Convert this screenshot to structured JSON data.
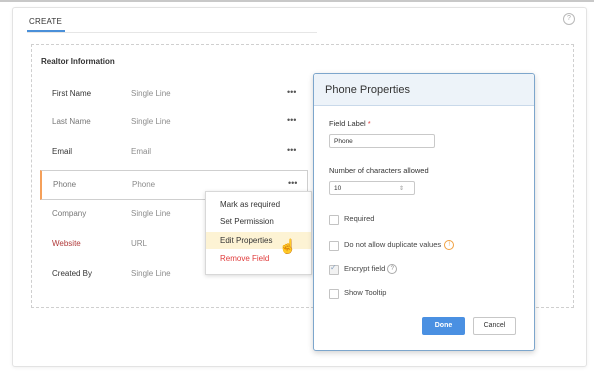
{
  "tabs": {
    "create": "CREATE"
  },
  "help_icon": "?",
  "section": {
    "title": "Realtor Information"
  },
  "fields": [
    {
      "label": "First Name",
      "type": "Single Line",
      "menu": "•••"
    },
    {
      "label": "Last Name",
      "type": "Single Line",
      "menu": "•••"
    },
    {
      "label": "Email",
      "type": "Email",
      "menu": "•••"
    },
    {
      "label": "Phone",
      "type": "Phone",
      "menu": "•••"
    },
    {
      "label": "Company",
      "type": "Single Line"
    },
    {
      "label": "Website",
      "type": "URL"
    },
    {
      "label": "Created By",
      "type": "Single Line"
    }
  ],
  "context_menu": {
    "items": [
      "Mark as required",
      "Set Permission",
      "Edit Properties",
      "Remove Field"
    ]
  },
  "properties": {
    "title": "Phone Properties",
    "field_label_label": "Field Label",
    "required_mark": "*",
    "field_label_value": "Phone",
    "chars_label": "Number of characters allowed",
    "chars_value": "10",
    "chars_arrow": "⇕",
    "options": [
      {
        "label": "Required",
        "checked": false
      },
      {
        "label": "Do not allow duplicate values",
        "checked": false,
        "info": "!"
      },
      {
        "label": "Encrypt field",
        "checked": true,
        "info": "?"
      },
      {
        "label": "Show Tooltip",
        "checked": false
      }
    ],
    "done_label": "Done",
    "cancel_label": "Cancel"
  },
  "colors": {
    "accent_blue": "#4a90e2",
    "active_border": "#f5a05a",
    "danger_red": "#e03b3b",
    "highlight": "#fdf3d4"
  },
  "icons": {
    "help": "help-circle-icon",
    "cursor": "hand-pointer-icon",
    "info": "info-circle-icon",
    "question": "question-circle-icon"
  }
}
